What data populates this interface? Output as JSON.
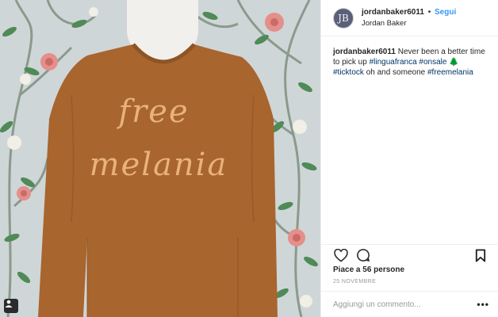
{
  "post": {
    "author": {
      "username": "jordanbaker6011",
      "display_name": "Jordan Baker",
      "avatar_initials": "JB",
      "follow_label": "Segui",
      "separator": "•"
    },
    "caption": {
      "username": "jordanbaker6011",
      "text_1": "Never been a better time to pick up",
      "hashtags_1": [
        "#linguafranca",
        "#onsale"
      ],
      "emoji": "🌲",
      "hashtags_2": [
        "#ticktock"
      ],
      "text_2": "oh and someone",
      "hashtags_3": [
        "#freemelania"
      ]
    },
    "likes_label": "Piace a 56 persone",
    "date_label": "25 NOVEMBRE",
    "comment_placeholder": "Aggiungi un commento...",
    "more_label": "•••"
  },
  "photo": {
    "sweater_text_line1": "free",
    "sweater_text_line2": "melania"
  },
  "icons": {
    "like": "heart-icon",
    "comment": "comment-icon",
    "save": "bookmark-icon",
    "tagged": "person-tag-icon"
  },
  "colors": {
    "link": "#003569",
    "follow": "#3897f0",
    "sweater": "#a8652e",
    "wallpaper": "#cfd6d8"
  }
}
